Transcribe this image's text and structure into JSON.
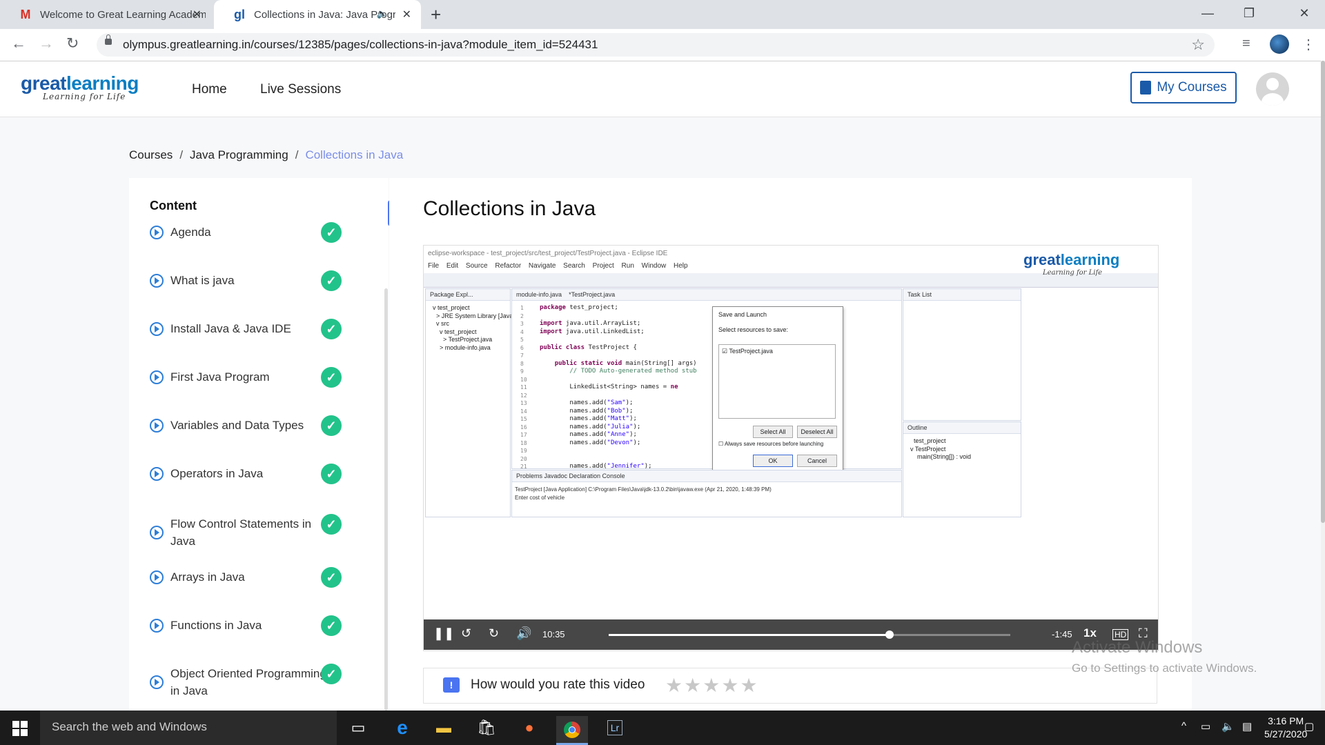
{
  "browser": {
    "tabs": [
      {
        "title": "Welcome to Great Learning Academy",
        "favicon": "gmail-icon"
      },
      {
        "title": "Collections in Java: Java Programming",
        "favicon": "greatlearning-icon",
        "active": true
      }
    ],
    "url": "olympus.greatlearning.in/courses/12385/pages/collections-in-java?module_item_id=524431"
  },
  "header": {
    "logo_main_a": "great",
    "logo_main_b": "learning",
    "logo_sub": "Learning for Life",
    "nav": [
      "Home",
      "Live Sessions"
    ],
    "my_courses": "My Courses"
  },
  "breadcrumb": [
    "Courses",
    "Java Programming",
    "Collections in Java"
  ],
  "sidebar": {
    "heading": "Content",
    "lessons": [
      {
        "label": "Agenda",
        "completed": true
      },
      {
        "label": "What is java",
        "completed": true
      },
      {
        "label": "Install Java & Java IDE",
        "completed": true
      },
      {
        "label": "First Java Program",
        "completed": true
      },
      {
        "label": "Variables and Data Types",
        "completed": true
      },
      {
        "label": "Operators in Java",
        "completed": true
      },
      {
        "label": "Flow Control Statements in Java",
        "completed": true
      },
      {
        "label": "Arrays in Java",
        "completed": true
      },
      {
        "label": "Functions in Java",
        "completed": true
      },
      {
        "label": "Object Oriented Programming in Java",
        "completed": true
      }
    ],
    "collapse_icon": "«"
  },
  "lesson_title": "Collections in Java",
  "video": {
    "ide_title": "eclipse-workspace - test_project/src/test_project/TestProject.java - Eclipse IDE",
    "ide_menu": "File Edit Source Refactor Navigate Search Project Run Window Help",
    "package_explorer": "Package Expl...",
    "tab_module": "module-info.java",
    "tab_project": "*TestProject.java",
    "task_list": "Task List",
    "outline": "Outline",
    "tree": "v test_project\n  > JRE System Library [JavaSE]\n  v src\n    v test_project\n      > TestProject.java\n    > module-info.java",
    "outline_tree": "  test_project\nv TestProject\n    main(String[]) : void",
    "dialog_title": "Save and Launch",
    "dialog_prompt": "Select resources to save:",
    "dialog_item": "TestProject.java",
    "dialog_select_all": "Select All",
    "dialog_deselect_all": "Deselect All",
    "dialog_checkbox": "Always save resources before launching",
    "dialog_ok": "OK",
    "dialog_cancel": "Cancel",
    "console_tabs": "Problems  Javadoc  Declaration  Console",
    "console_text": "TestProject [Java Application] C:\\Program Files\\Java\\jdk-13.0.2\\bin\\javaw.exe (Apr 21, 2020, 1:48:39 PM)\nEnter cost of vehicle",
    "video_logo_a": "great",
    "video_logo_b": "learning",
    "video_logo_sub": "Learning for Life",
    "elapsed": "10:35",
    "remaining": "-1:45",
    "speed": "1x",
    "progress": 0.7
  },
  "rating": {
    "prompt": "How would you rate this video",
    "stars": 5,
    "rating": 0
  },
  "watermark": {
    "line1": "Activate Windows",
    "line2": "Go to Settings to activate Windows."
  },
  "taskbar": {
    "search_placeholder": "Search the web and Windows",
    "time": "3:16 PM",
    "date": "5/27/2020"
  }
}
